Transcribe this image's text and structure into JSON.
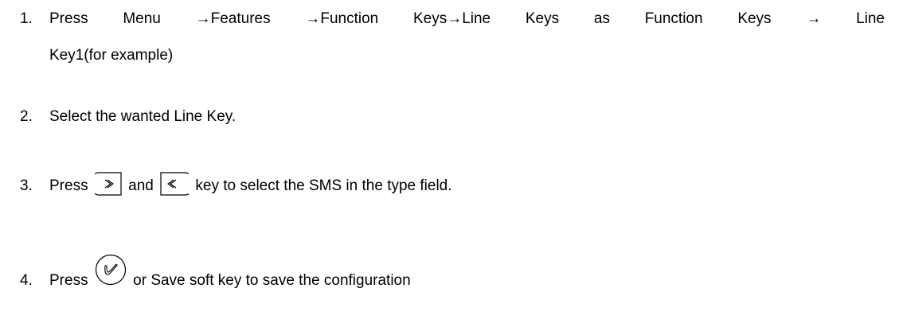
{
  "steps": [
    {
      "number": "1.",
      "line1": "Press Menu →Features →Function Keys→Line Keys as Function Keys → Line",
      "line2": "Key1(for example)"
    },
    {
      "number": "2.",
      "text": "Select the wanted Line Key."
    },
    {
      "number": "3.",
      "text_a": "Press",
      "text_b": "and",
      "text_c": "key to select the SMS in the type field.",
      "icon_1": "right-arrow-key-icon",
      "icon_2": "left-arrow-key-icon"
    },
    {
      "number": "4.",
      "text_a": "Press",
      "text_b": "or Save soft key to save the configuration",
      "icon_1": "ok-key-icon"
    }
  ]
}
